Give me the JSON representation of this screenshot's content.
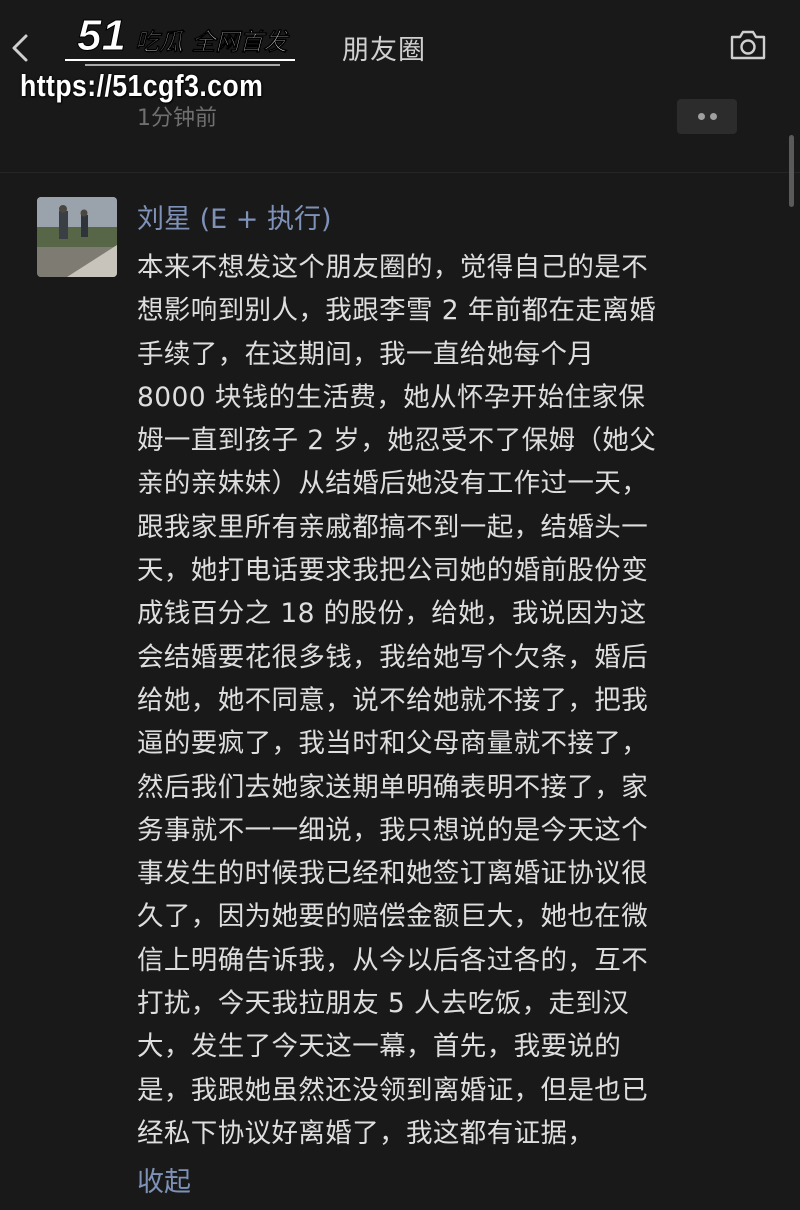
{
  "watermark": {
    "logo_text": "51吃瓜 全网首发",
    "url": "https://51cgf3.com"
  },
  "header": {
    "title": "朋友圈",
    "back_icon": "chevron-left-icon",
    "camera_icon": "camera-icon"
  },
  "previous_post": {
    "time_ago": "1分钟前",
    "more_icon": "more-dots-icon"
  },
  "post": {
    "username": "刘星 (E + 执行)",
    "lines": [
      "本来不想发这个朋友圈的，觉得自己的是不",
      "想影响到别人，我跟李雪 2 年前都在走离婚",
      "手续了，在这期间，我一直给她每个月",
      "8000 块钱的生活费，她从怀孕开始住家保",
      "姆一直到孩子 2 岁，她忍受不了保姆（她父",
      "亲的亲妹妹）从结婚后她没有工作过一天，",
      "跟我家里所有亲戚都搞不到一起，结婚头一",
      "天，她打电话要求我把公司她的婚前股份变",
      "成钱百分之 18 的股份，给她，我说因为这",
      "会结婚要花很多钱，我给她写个欠条，婚后",
      "给她，她不同意，说不给她就不接了，把我",
      "逼的要疯了，我当时和父母商量就不接了，",
      "然后我们去她家送期单明确表明不接了，家",
      "务事就不一一细说，我只想说的是今天这个",
      "事发生的时候我已经和她签订离婚证协议很",
      "久了，因为她要的赔偿金额巨大，她也在微",
      "信上明确告诉我，从今以后各过各的，互不",
      "打扰，今天我拉朋友 5 人去吃饭，走到汉",
      "大，发生了今天这一幕，首先，我要说的",
      "是，我跟她虽然还没领到离婚证，但是也已",
      "经私下协议好离婚了，我这都有证据，"
    ],
    "collapse_label": "收起"
  },
  "colors": {
    "background": "#191919",
    "link": "#7e92b8",
    "text": "#dedede",
    "muted": "#6f6f6f"
  }
}
